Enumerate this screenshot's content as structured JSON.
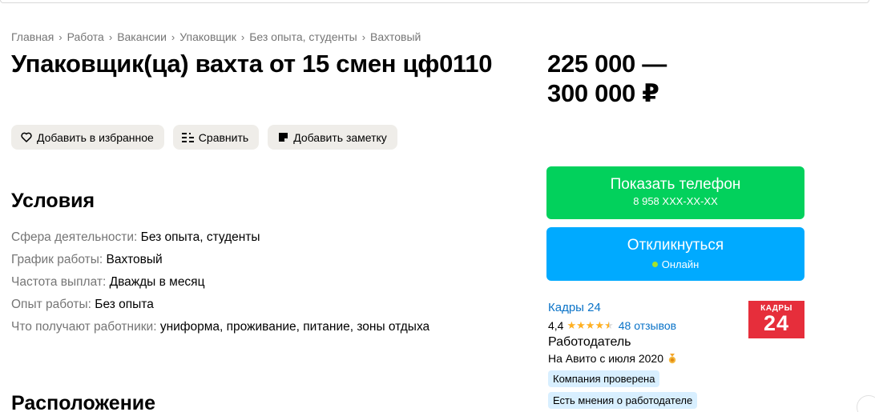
{
  "breadcrumb": [
    "Главная",
    "Работа",
    "Вакансии",
    "Упаковщик",
    "Без опыта, студенты",
    "Вахтовый"
  ],
  "title": "Упаковщик(ца) вахта от 15 смен цф0110",
  "actions": {
    "favorite": "Добавить в избранное",
    "compare": "Сравнить",
    "note": "Добавить заметку"
  },
  "price": {
    "line1": "225 000 —",
    "line2": "300 000 ₽"
  },
  "contact": {
    "phone_label": "Показать телефон",
    "phone_number": "8 958 XXX-XX-XX",
    "reply_label": "Откликнуться",
    "status": "Онлайн"
  },
  "conditions": {
    "heading": "Условия",
    "items": [
      {
        "key": "Сфера деятельности:",
        "value": "Без опыта, студенты"
      },
      {
        "key": "График работы:",
        "value": "Вахтовый"
      },
      {
        "key": "Частота выплат:",
        "value": "Дважды в месяц"
      },
      {
        "key": "Опыт работы:",
        "value": "Без опыта"
      },
      {
        "key": "Что получают работники:",
        "value": "униформа, проживание, питание, зоны отдыха"
      }
    ]
  },
  "location": {
    "heading": "Расположение"
  },
  "seller": {
    "name": "Кадры 24",
    "rating": "4,4",
    "stars": 4.4,
    "reviews": "48 отзывов",
    "type": "Работодатель",
    "since": "На Авито с июля 2020",
    "chips": [
      "Компания проверена",
      "Есть мнения о работодателе"
    ],
    "logo_text_top": "КАДРЫ",
    "logo_text_bottom": "24"
  },
  "colors": {
    "green": "#02d15c",
    "blue": "#00aaff",
    "link": "#0a73c8",
    "star": "#ffb021",
    "logo_red": "#e62e3b"
  }
}
